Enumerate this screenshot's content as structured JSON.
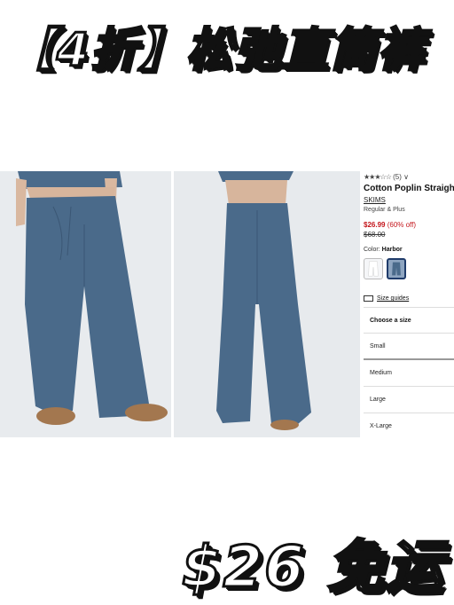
{
  "banner": {
    "text": "【4折】松弛直筒裤"
  },
  "product": {
    "rating_stars": "★★★☆☆",
    "rating_count": "(5)",
    "rating_chevron": "∨",
    "title": "Cotton Poplin Straight",
    "brand": "SKIMS",
    "variant": "Regular & Plus",
    "price": "$26.99",
    "discount": "(60% off)",
    "old_price": "$68.00",
    "color_label": "Color:",
    "color_value": "Harbor",
    "size_guide_label": "Size guides",
    "sizes_header": "Choose a size",
    "sizes": [
      "Small",
      "Medium",
      "Large",
      "X-Large"
    ],
    "colors": {
      "price_red": "#c4161c",
      "pants": "#4a6a8a",
      "selected_swatch": "#1f3b6a"
    }
  },
  "caption": {
    "text": "$26 免运"
  }
}
